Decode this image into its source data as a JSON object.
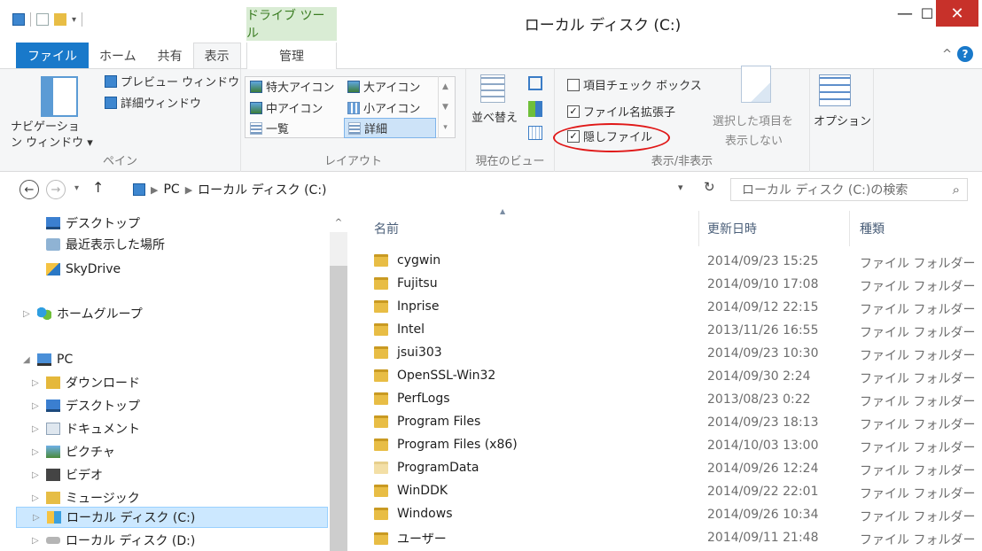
{
  "window": {
    "title": "ローカル ディスク (C:)",
    "contextual_tab_header": "ドライブ ツール",
    "minimize_glyph": "—",
    "maximize_glyph": "☐",
    "close_glyph": "✕"
  },
  "ribbon_tabs": {
    "file": "ファイル",
    "home": "ホーム",
    "share": "共有",
    "view": "表示",
    "manage": "管理",
    "collapse_glyph": "^",
    "help_glyph": "?"
  },
  "ribbon": {
    "pane": {
      "navigation_pane": "ナビゲーショ\nン ウィンドウ ▾",
      "navigation_pane_line1": "ナビゲーショ",
      "navigation_pane_line2": "ン ウィンドウ ▾",
      "preview_pane": "プレビュー ウィンドウ",
      "details_pane": "詳細ウィンドウ",
      "label": "ペイン"
    },
    "layout": {
      "extra_large_icons": "特大アイコン",
      "large_icons": "大アイコン",
      "medium_icons": "中アイコン",
      "small_icons": "小アイコン",
      "list": "一覧",
      "details": "詳細",
      "label": "レイアウト"
    },
    "current_view": {
      "sort_by": "並べ替え",
      "label": "現在のビュー"
    },
    "show_hide": {
      "item_checkboxes": "項目チェック ボックス",
      "item_checkboxes_checked": false,
      "file_name_extensions": "ファイル名拡張子",
      "file_name_extensions_checked": true,
      "hidden_items": "隠しファイル",
      "hidden_items_checked": true,
      "hide_selected_line1": "選択した項目を",
      "hide_selected_line2": "表示しない",
      "label": "表示/非表示"
    },
    "options": "オプション",
    "check_glyph": "✓"
  },
  "address": {
    "path": [
      "PC",
      "ローカル ディスク (C:)"
    ],
    "back_glyph": "←",
    "forward_glyph": "→",
    "up_glyph": "↑",
    "refresh_glyph": "↻",
    "search_placeholder": "ローカル ディスク (C:)の検索",
    "search_glyph": "⌕"
  },
  "nav_pane": {
    "items": [
      {
        "label": "デスクトップ",
        "icon": "desktop-icon"
      },
      {
        "label": "最近表示した場所",
        "icon": "recent-places-icon"
      },
      {
        "label": "SkyDrive",
        "icon": "skydrive-icon"
      },
      {
        "label": "ホームグループ",
        "icon": "homegroup-icon"
      },
      {
        "label": "PC",
        "icon": "pc-icon"
      },
      {
        "label": "ダウンロード",
        "icon": "downloads-icon"
      },
      {
        "label": "デスクトップ",
        "icon": "desktop-icon"
      },
      {
        "label": "ドキュメント",
        "icon": "documents-icon"
      },
      {
        "label": "ピクチャ",
        "icon": "pictures-icon"
      },
      {
        "label": "ビデオ",
        "icon": "videos-icon"
      },
      {
        "label": "ミュージック",
        "icon": "music-icon"
      },
      {
        "label": "ローカル ディスク (C:)",
        "icon": "drive-c-icon",
        "selected": true
      },
      {
        "label": "ローカル ディスク (D:)",
        "icon": "drive-d-icon"
      }
    ]
  },
  "file_list": {
    "columns": {
      "name": "名前",
      "modified": "更新日時",
      "type": "種類"
    },
    "rows": [
      {
        "name": "cygwin",
        "modified": "2014/09/23 15:25",
        "type": "ファイル フォルダー"
      },
      {
        "name": "Fujitsu",
        "modified": "2014/09/10 17:08",
        "type": "ファイル フォルダー"
      },
      {
        "name": "Inprise",
        "modified": "2014/09/12 22:15",
        "type": "ファイル フォルダー"
      },
      {
        "name": "Intel",
        "modified": "2013/11/26 16:55",
        "type": "ファイル フォルダー"
      },
      {
        "name": "jsui303",
        "modified": "2014/09/23 10:30",
        "type": "ファイル フォルダー"
      },
      {
        "name": "OpenSSL-Win32",
        "modified": "2014/09/30 2:24",
        "type": "ファイル フォルダー"
      },
      {
        "name": "PerfLogs",
        "modified": "2013/08/23 0:22",
        "type": "ファイル フォルダー"
      },
      {
        "name": "Program Files",
        "modified": "2014/09/23 18:13",
        "type": "ファイル フォルダー"
      },
      {
        "name": "Program Files (x86)",
        "modified": "2014/10/03 13:00",
        "type": "ファイル フォルダー"
      },
      {
        "name": "ProgramData",
        "modified": "2014/09/26 12:24",
        "type": "ファイル フォルダー",
        "hidden": true
      },
      {
        "name": "WinDDK",
        "modified": "2014/09/22 22:01",
        "type": "ファイル フォルダー"
      },
      {
        "name": "Windows",
        "modified": "2014/09/26 10:34",
        "type": "ファイル フォルダー"
      },
      {
        "name": "ユーザー",
        "modified": "2014/09/11 21:48",
        "type": "ファイル フォルダー"
      }
    ]
  }
}
